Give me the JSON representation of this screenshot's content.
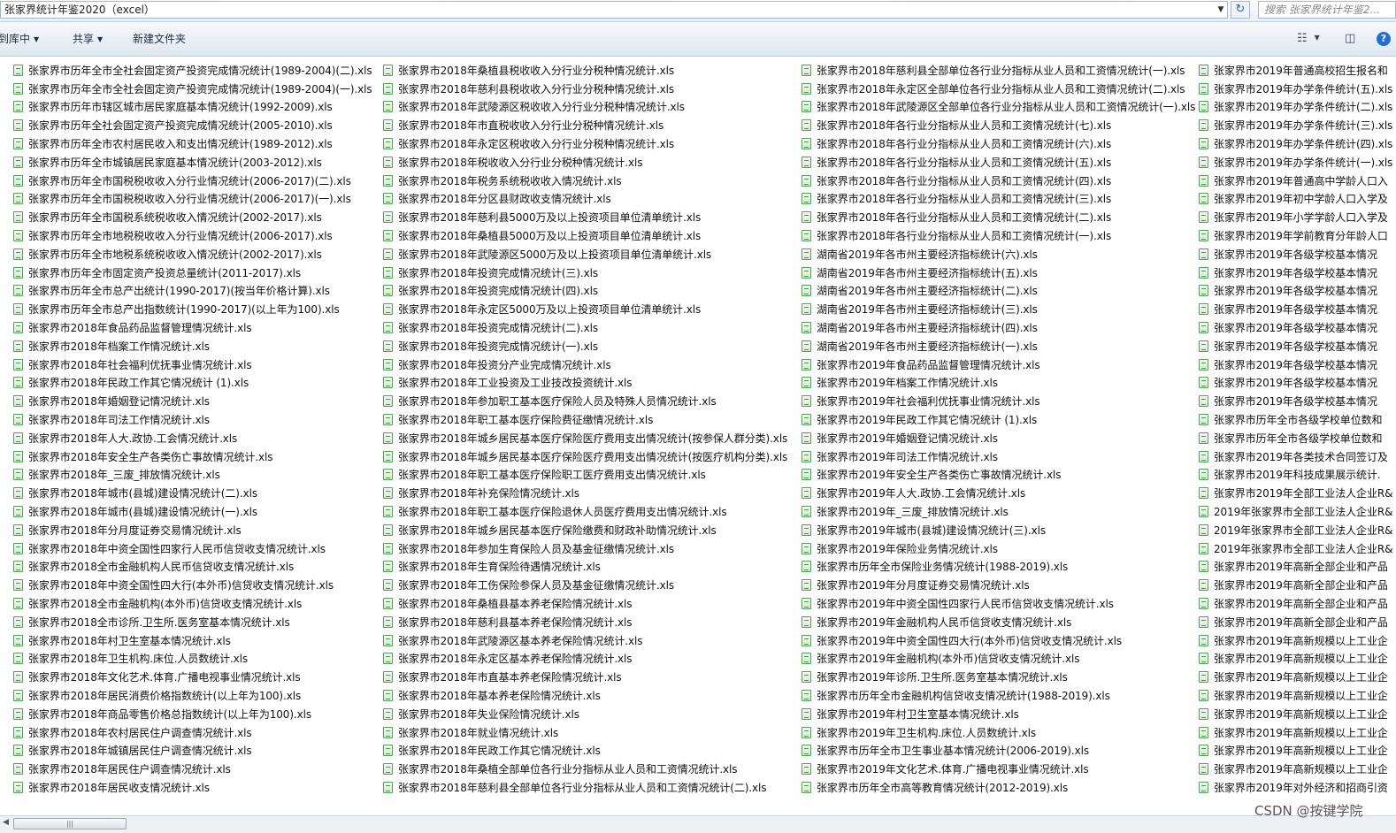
{
  "address": {
    "path": "张家界统计年鉴2020（excel）",
    "search_placeholder": "搜索 张家界统计年鉴2..."
  },
  "toolbar": {
    "include_label": "到库中",
    "share_label": "共享",
    "new_folder_label": "新建文件夹"
  },
  "columns": [
    {
      "files": [
        "张家界市历年全市全社会固定资产投资完成情况统计(1989-2004)(二).xls",
        "张家界市历年全市全社会固定资产投资完成情况统计(1989-2004)(一).xls",
        "张家界市历年市辖区城市居民家庭基本情况统计(1992-2009).xls",
        "张家界市历年全社会固定资产投资完成情况统计(2005-2010).xls",
        "张家界市历年全市农村居民收入和支出情况统计(1989-2012).xls",
        "张家界市历年全市城镇居民家庭基本情况统计(2003-2012).xls",
        "张家界市历年全市国税税收收入分行业情况统计(2006-2017)(二).xls",
        "张家界市历年全市国税税收收入分行业情况统计(2006-2017)(一).xls",
        "张家界市历年全市国税系统税收收入情况统计(2002-2017).xls",
        "张家界市历年全市地税税收收入分行业情况统计(2006-2017).xls",
        "张家界市历年全市地税系统税收收入情况统计(2002-2017).xls",
        "张家界市历年全市固定资产投资总量统计(2011-2017).xls",
        "张家界市历年全市总产出统计(1990-2017)(按当年价格计算).xls",
        "张家界市历年全市总产出指数统计(1990-2017)(以上年为100).xls",
        "张家界市2018年食品药品监督管理情况统计.xls",
        "张家界市2018年档案工作情况统计.xls",
        "张家界市2018年社会福利优抚事业情况统计.xls",
        "张家界市2018年民政工作其它情况统计 (1).xls",
        "张家界市2018年婚姻登记情况统计.xls",
        "张家界市2018年司法工作情况统计.xls",
        "张家界市2018年人大.政协.工会情况统计.xls",
        "张家界市2018年安全生产各类伤亡事故情况统计.xls",
        "张家界市2018年_三废_排放情况统计.xls",
        "张家界市2018年城市(县城)建设情况统计(二).xls",
        "张家界市2018年城市(县城)建设情况统计(一).xls",
        "张家界市2018年分月度证券交易情况统计.xls",
        "张家界市2018年中资全国性四家行人民币信贷收支情况统计.xls",
        "张家界市2018全市金融机构人民币信贷收支情况统计.xls",
        "张家界市2018年中资全国性四大行(本外币)信贷收支情况统计.xls",
        "张家界市2018全市金融机构(本外币)信贷收支情况统计.xls",
        "张家界市2018全市诊所.卫生所.医务室基本情况统计.xls",
        "张家界市2018年村卫生室基本情况统计.xls",
        "张家界市2018年卫生机构.床位.人员数统计.xls",
        "张家界市2018年文化艺术.体育.广播电视事业情况统计.xls",
        "张家界市2018年居民消费价格指数统计(以上年为100).xls",
        "张家界市2018年商品零售价格总指数统计(以上年为100).xls",
        "张家界市2018年农村居民住户调查情况统计.xls",
        "张家界市2018年城镇居民住户调查情况统计.xls",
        "张家界市2018年居民住户调查情况统计.xls",
        "张家界市2018年居民收支情况统计.xls"
      ]
    },
    {
      "files": [
        "张家界市2018年桑植县税收收入分行业分税种情况统计.xls",
        "张家界市2018年慈利县税收收入分行业分税种情况统计.xls",
        "张家界市2018年武陵源区税收收入分行业分税种情况统计.xls",
        "张家界市2018年市直税收收入分行业分税种情况统计.xls",
        "张家界市2018年永定区税收收入分行业分税种情况统计.xls",
        "张家界市2018年税收收入分行业分税种情况统计.xls",
        "张家界市2018年税务系统税收收入情况统计.xls",
        "张家界市2018年分区县财政收支情况统计.xls",
        "张家界市2018年慈利县5000万及以上投资项目单位清单统计.xls",
        "张家界市2018年桑植县5000万及以上投资项目单位清单统计.xls",
        "张家界市2018年武陵源区5000万及以上投资项目单位清单统计.xls",
        "张家界市2018年投资完成情况统计(三).xls",
        "张家界市2018年投资完成情况统计(四).xls",
        "张家界市2018年永定区5000万及以上投资项目单位清单统计.xls",
        "张家界市2018年投资完成情况统计(二).xls",
        "张家界市2018年投资完成情况统计(一).xls",
        "张家界市2018年投资分产业完成情况统计.xls",
        "张家界市2018年工业投资及工业技改投资统计.xls",
        "张家界市2018年参加职工基本医疗保险人员及特殊人员情况统计.xls",
        "张家界市2018年职工基本医疗保险费征缴情况统计.xls",
        "张家界市2018年城乡居民基本医疗保险医疗费用支出情况统计(按参保人群分类).xls",
        "张家界市2018年城乡居民基本医疗保险医疗费用支出情况统计(按医疗机构分类).xls",
        "张家界市2018年职工基本医疗保险职工医疗费用支出情况统计.xls",
        "张家界市2018年补充保险情况统计.xls",
        "张家界市2018年职工基本医疗保险退休人员医疗费用支出情况统计.xls",
        "张家界市2018年城乡居民基本医疗保险缴费和财政补助情况统计.xls",
        "张家界市2018年参加生育保险人员及基金征缴情况统计.xls",
        "张家界市2018年生育保险待遇情况统计.xls",
        "张家界市2018年工伤保险参保人员及基金征缴情况统计.xls",
        "张家界市2018年桑植县基本养老保险情况统计.xls",
        "张家界市2018年慈利县基本养老保险情况统计.xls",
        "张家界市2018年武陵源区基本养老保险情况统计.xls",
        "张家界市2018年永定区基本养老保险情况统计.xls",
        "张家界市2018年市直基本养老保险情况统计.xls",
        "张家界市2018年基本养老保险情况统计.xls",
        "张家界市2018年失业保险情况统计.xls",
        "张家界市2018年就业情况统计.xls",
        "张家界市2018年民政工作其它情况统计.xls",
        "张家界市2018年桑植全部单位各行业分指标从业人员和工资情况统计.xls",
        "张家界市2018年慈利县全部单位各行业分指标从业人员和工资情况统计(二).xls"
      ]
    },
    {
      "files": [
        "张家界市2018年慈利县全部单位各行业分指标从业人员和工资情况统计(一).xls",
        "张家界市2018年永定区全部单位各行业分指标从业人员和工资情况统计(二).xls",
        "张家界市2018年武陵源区全部单位各行业分指标从业人员和工资情况统计(一).xls",
        "张家界市2018年各行业分指标从业人员和工资情况统计(七).xls",
        "张家界市2018年各行业分指标从业人员和工资情况统计(六).xls",
        "张家界市2018年各行业分指标从业人员和工资情况统计(五).xls",
        "张家界市2018年各行业分指标从业人员和工资情况统计(四).xls",
        "张家界市2018年各行业分指标从业人员和工资情况统计(三).xls",
        "张家界市2018年各行业分指标从业人员和工资情况统计(二).xls",
        "张家界市2018年各行业分指标从业人员和工资情况统计(一).xls",
        "湖南省2019年各市州主要经济指标统计(六).xls",
        "湖南省2019年各市州主要经济指标统计(五).xls",
        "湖南省2019年各市州主要经济指标统计(二).xls",
        "湖南省2019年各市州主要经济指标统计(三).xls",
        "湖南省2019年各市州主要经济指标统计(四).xls",
        "湖南省2019年各市州主要经济指标统计(一).xls",
        "张家界市2019年食品药品监督管理情况统计.xls",
        "张家界市2019年档案工作情况统计.xls",
        "张家界市2019年社会福利优抚事业情况统计.xls",
        "张家界市2019年民政工作其它情况统计 (1).xls",
        "张家界市2019年婚姻登记情况统计.xls",
        "张家界市2019年司法工作情况统计.xls",
        "张家界市2019年安全生产各类伤亡事故情况统计.xls",
        "张家界市2019年人大.政协.工会情况统计.xls",
        "张家界市2019年_三废_排放情况统计.xls",
        "张家界市2019年城市(县城)建设情况统计(三).xls",
        "张家界市2019年保险业务情况统计.xls",
        "张家界市历年全市保险业务情况统计(1988-2019).xls",
        "张家界市2019年分月度证券交易情况统计.xls",
        "张家界市2019年中资全国性四家行人民币信贷收支情况统计.xls",
        "张家界市2019年金融机构人民币信贷收支情况统计.xls",
        "张家界市2019年中资全国性四大行(本外币)信贷收支情况统计.xls",
        "张家界市2019年金融机构(本外币)信贷收支情况统计.xls",
        "张家界市2019年诊所.卫生所.医务室基本情况统计.xls",
        "张家界市历年全市金融机构信贷收支情况统计(1988-2019).xls",
        "张家界市2019年村卫生室基本情况统计.xls",
        "张家界市2019年卫生机构.床位.人员数统计.xls",
        "张家界市历年全市卫生事业基本情况统计(2006-2019).xls",
        "张家界市2019年文化艺术.体育.广播电视事业情况统计.xls",
        "张家界市历年全市高等教育情况统计(2012-2019).xls"
      ]
    },
    {
      "files": [
        "张家界市2019年普通高校招生报名和",
        "张家界市2019年办学条件统计(五).xls",
        "张家界市2019年办学条件统计(二).xls",
        "张家界市2019年办学条件统计(三).xls",
        "张家界市2019年办学条件统计(四).xls",
        "张家界市2019年办学条件统计(一).xls",
        "张家界市2019年普通高中学龄人口入",
        "张家界市2019年初中学龄人口入学及",
        "张家界市2019年小学学龄人口入学及",
        "张家界市2019年学前教育分年龄人口",
        "张家界市2019年各级学校基本情况",
        "张家界市2019年各级学校基本情况",
        "张家界市2019年各级学校基本情况",
        "张家界市2019年各级学校基本情况",
        "张家界市2019年各级学校基本情况",
        "张家界市2019年各级学校基本情况",
        "张家界市2019年各级学校基本情况",
        "张家界市2019年各级学校基本情况",
        "张家界市2019年各级学校基本情况",
        "张家界市历年全市各级学校单位数和",
        "张家界市历年全市各级学校单位数和",
        "张家界市2019年各类技术合同签订及",
        "张家界市2019年科技成果展示统计.",
        "张家界市2019年全部工业法人企业R&",
        "2019年张家界市全部工业法人企业R&",
        "2019年张家界市全部工业法人企业R&",
        "2019年张家界市全部工业法人企业R&",
        "张家界市2019年高新全部企业和产品",
        "张家界市2019年高新全部企业和产品",
        "张家界市2019年高新全部企业和产品",
        "张家界市2019年高新全部企业和产品",
        "张家界市2019年高新规模以上工业企",
        "张家界市2019年高新规模以上工业企",
        "张家界市2019年高新规模以上工业企",
        "张家界市2019年高新规模以上工业企",
        "张家界市2019年高新规模以上工业企",
        "张家界市2019年高新规模以上工业企",
        "张家界市2019年高新规模以上工业企",
        "张家界市2019年高新规模以上工业企",
        "张家界市2019年对外经济和招商引资"
      ]
    }
  ],
  "watermark": "CSDN @按键学院"
}
